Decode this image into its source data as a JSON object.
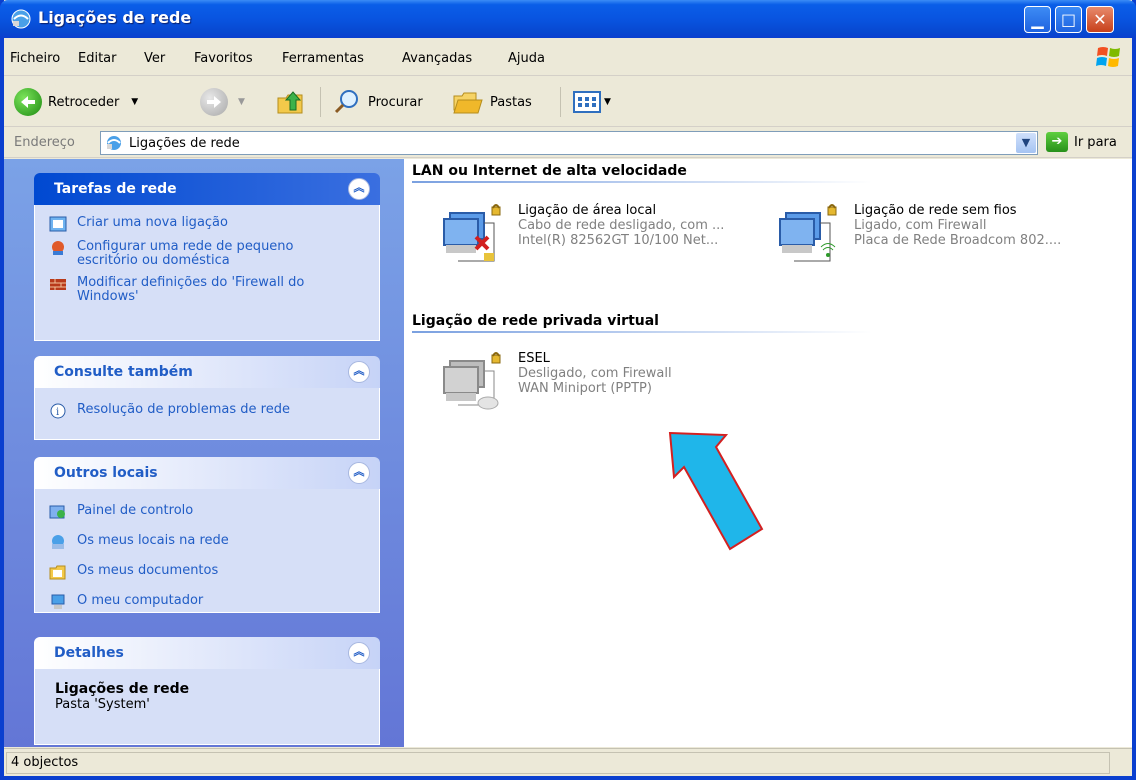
{
  "window": {
    "title": "Ligações de rede",
    "min_glyph": "▁",
    "max_glyph": "□",
    "close_glyph": "✕"
  },
  "menu": [
    "Ficheiro",
    "Editar",
    "Ver",
    "Favoritos",
    "Ferramentas",
    "Avançadas",
    "Ajuda"
  ],
  "toolbar": {
    "back_label": "Retroceder",
    "search_label": "Procurar",
    "folders_label": "Pastas"
  },
  "address": {
    "label": "Endereço",
    "value": "Ligações de rede",
    "go_label": "Ir para"
  },
  "panels": {
    "network_tasks": {
      "title": "Tarefas de rede",
      "items": [
        "Criar uma nova ligação",
        "Configurar uma rede de pequeno escritório ou doméstica",
        "Modificar definições do 'Firewall do Windows'"
      ]
    },
    "see_also": {
      "title": "Consulte também",
      "items": [
        "Resolução de problemas de rede"
      ]
    },
    "other_places": {
      "title": "Outros locais",
      "items": [
        "Painel de controlo",
        "Os meus locais na rede",
        "Os meus documentos",
        "O meu computador"
      ]
    },
    "details": {
      "title": "Detalhes",
      "name": "Ligações de rede",
      "type": "Pasta 'System'"
    }
  },
  "groups": {
    "lan": {
      "title": "LAN ou Internet de alta velocidade",
      "connections": [
        {
          "name": "Ligação de área local",
          "status": "Cabo de rede desligado, com ...",
          "device": "Intel(R) 82562GT 10/100 Net..."
        },
        {
          "name": "Ligação de rede sem fios",
          "status": "Ligado, com Firewall",
          "device": "Placa de Rede Broadcom 802...."
        }
      ]
    },
    "vpn": {
      "title": "Ligação de rede privada virtual",
      "connections": [
        {
          "name": "ESEL",
          "status": "Desligado, com Firewall",
          "device": "WAN Miniport (PPTP)"
        }
      ]
    }
  },
  "status": {
    "text": "4 objectos"
  },
  "colors": {
    "titlebar": "#0a5ee8",
    "task_link": "#215dc6",
    "pane_bg": "#6f8fe0",
    "arrow_fill": "#1fb6ea",
    "arrow_stroke": "#d42020"
  }
}
